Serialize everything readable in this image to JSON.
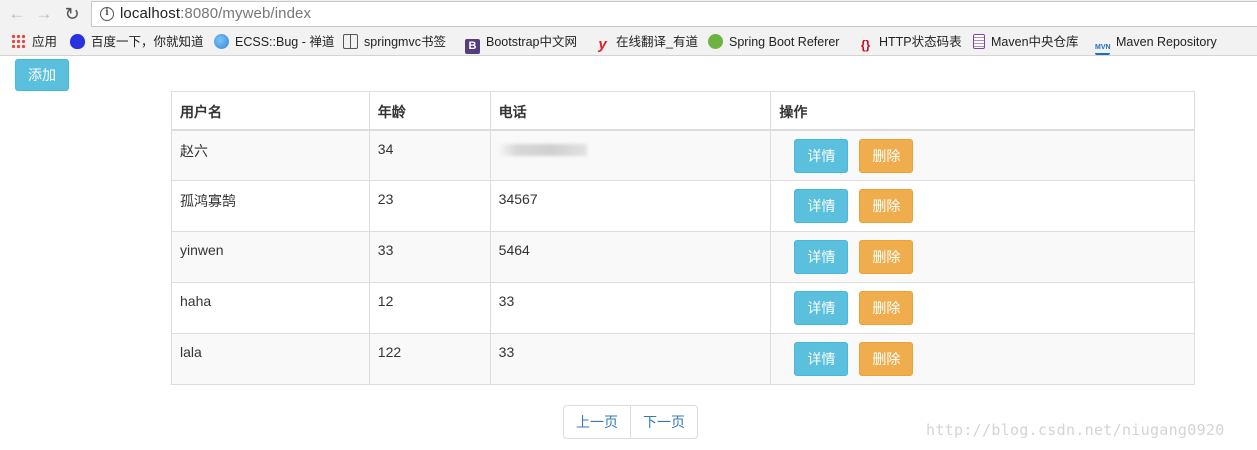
{
  "browser": {
    "url_host": "localhost",
    "url_rest": ":8080/myweb/index",
    "bookmarks": [
      {
        "label": "应用",
        "icon": "apps-icon",
        "color": "#e8453c"
      },
      {
        "label": "百度一下，你就知道",
        "icon": "baidu-icon",
        "color": "#2932e1"
      },
      {
        "label": "ECSS::Bug - 禅道",
        "icon": "zentao-icon",
        "color": "#2b87d8"
      },
      {
        "label": "springmvc书签",
        "icon": "book-icon",
        "color": "#555555"
      },
      {
        "label": "Bootstrap中文网",
        "icon": "bootstrap-icon",
        "color": "#563d7c"
      },
      {
        "label": "在线翻译_有道",
        "icon": "youdao-icon",
        "color": "#e02020"
      },
      {
        "label": "Spring Boot Referer",
        "icon": "spring-icon",
        "color": "#6db33f"
      },
      {
        "label": "HTTP状态码表",
        "icon": "braces-icon",
        "color": "#d0021b"
      },
      {
        "label": "Maven中央仓库",
        "icon": "maven-doc-icon",
        "color": "#7a4a9a"
      },
      {
        "label": "Maven Repository",
        "icon": "mvn-icon",
        "color": "#1d6fb8"
      }
    ]
  },
  "page": {
    "add_label": "添加",
    "columns": [
      "用户名",
      "年龄",
      "电话",
      "操作"
    ],
    "rows": [
      {
        "name": "赵六",
        "age": "34",
        "phone": "",
        "phone_obscured": true
      },
      {
        "name": "孤鸿寡鹄",
        "age": "23",
        "phone": "34567"
      },
      {
        "name": "yinwen",
        "age": "33",
        "phone": "5464"
      },
      {
        "name": "haha",
        "age": "12",
        "phone": "33"
      },
      {
        "name": "lala",
        "age": "122",
        "phone": "33"
      }
    ],
    "detail_label": "详情",
    "delete_label": "删除",
    "prev_label": "上一页",
    "next_label": "下一页",
    "watermark": "http://blog.csdn.net/niugang0920"
  }
}
